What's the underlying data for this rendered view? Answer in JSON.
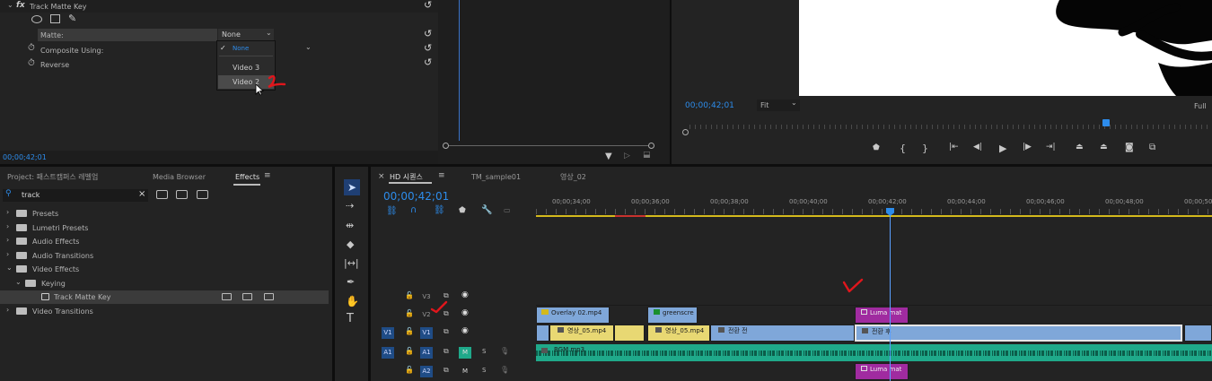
{
  "effect_controls": {
    "fx_label": "fx",
    "effect_name": "Track Matte Key",
    "matte_label": "Matte:",
    "matte_value": "None",
    "composite_label": "Composite Using:",
    "reverse_label": "Reverse",
    "dropdown_options": [
      "None",
      "Video 3",
      "Video 2"
    ],
    "timecode": "00;00;42;01"
  },
  "program_monitor": {
    "timecode": "00;00;42;01",
    "fit_label": "Fit",
    "full_label": "Full"
  },
  "project_panel": {
    "tabs": [
      "Project: 패스트캠퍼스 레벨업",
      "Media Browser",
      "Effects"
    ],
    "search_value": "track",
    "tree": [
      {
        "label": "Presets",
        "indent": 0,
        "icon": "folder-star-icon"
      },
      {
        "label": "Lumetri Presets",
        "indent": 0,
        "icon": "folder-star-icon"
      },
      {
        "label": "Audio Effects",
        "indent": 0,
        "icon": "folder-icon"
      },
      {
        "label": "Audio Transitions",
        "indent": 0,
        "icon": "folder-icon"
      },
      {
        "label": "Video Effects",
        "indent": 0,
        "icon": "folder-icon"
      },
      {
        "label": "Keying",
        "indent": 1,
        "icon": "folder-icon"
      },
      {
        "label": "Track Matte Key",
        "indent": 2,
        "icon": "effect-icon"
      },
      {
        "label": "Video Transitions",
        "indent": 0,
        "icon": "folder-icon"
      }
    ]
  },
  "sequence": {
    "tabs": [
      "HD 시퀀스",
      "TM_sample01",
      "영상_02"
    ],
    "timecode": "00;00;42;01",
    "ruler": [
      "00;00;34;00",
      "00;00;36;00",
      "00;00;38;00",
      "00;00;40;00",
      "00;00;42;00",
      "00;00;44;00",
      "00;00;46;00",
      "00;00;48;00",
      "00;00;50"
    ],
    "tracks": [
      {
        "src": "",
        "name": "V3"
      },
      {
        "src": "",
        "name": "V2"
      },
      {
        "src": "V1",
        "name": "V1"
      },
      {
        "src": "A1",
        "name": "A1",
        "m": "M",
        "s": "S"
      },
      {
        "src": "",
        "name": "A2",
        "m": "M",
        "s": "S"
      }
    ],
    "clips_v2": [
      "Overlay 02.mp4",
      "greenscre",
      "Luma mat"
    ],
    "clips_v1": [
      "영상_05.mp4",
      "영상_05.mp4",
      "전환 전",
      "전환 후"
    ],
    "clip_a1": "BGM.mp3",
    "clip_a2": "Luma mat"
  },
  "colors": {
    "accent": "#2d8ceb",
    "playhead": "#5aa0ff",
    "v1_clip": "#7fa7d9",
    "yellow_clip": "#e8d873",
    "magenta_clip": "#a02ba0",
    "audio_clip": "#1fa98a"
  }
}
